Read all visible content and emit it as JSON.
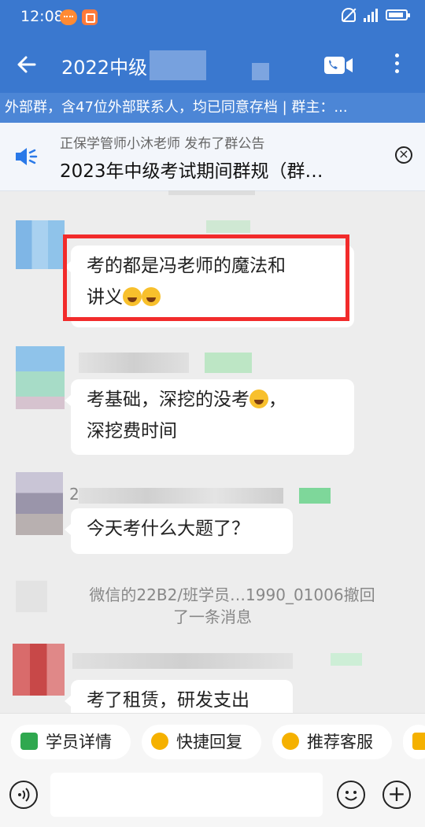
{
  "status_bar": {
    "time": "12:08"
  },
  "header": {
    "title": "2022中级",
    "subtitle": "外部群，含47位外部联系人，均已同意存档 | 群主：..."
  },
  "announcement": {
    "publisher": "正保学管师小沐老师 发布了群公告",
    "text": "2023年中级考试期间群规（群…"
  },
  "messages": [
    {
      "text_line1": "考的都是冯老师的魔法和",
      "text_line2": "讲义"
    },
    {
      "text_line1": "考基础，深挖的没考",
      "text_line1_tail": "，",
      "text_line2": "深挖费时间"
    },
    {
      "sender_prefix": "2",
      "text": "今天考什么大题了？"
    },
    {
      "text": "考了租赁，研发支出"
    }
  ],
  "system_message": {
    "line1": "微信的22B2/班学员…1990_01006撤回",
    "line2": "了一条消息"
  },
  "quick_replies": [
    {
      "label": "学员详情",
      "icon": "user-icon",
      "color": "#2fa84f"
    },
    {
      "label": "快捷回复",
      "icon": "quick-reply-icon",
      "color": "#f5b100"
    },
    {
      "label": "推荐客服",
      "icon": "service-icon",
      "color": "#f5b100"
    }
  ],
  "colors": {
    "header_bg": "#3a78cf",
    "highlight": "#f22b2b"
  }
}
